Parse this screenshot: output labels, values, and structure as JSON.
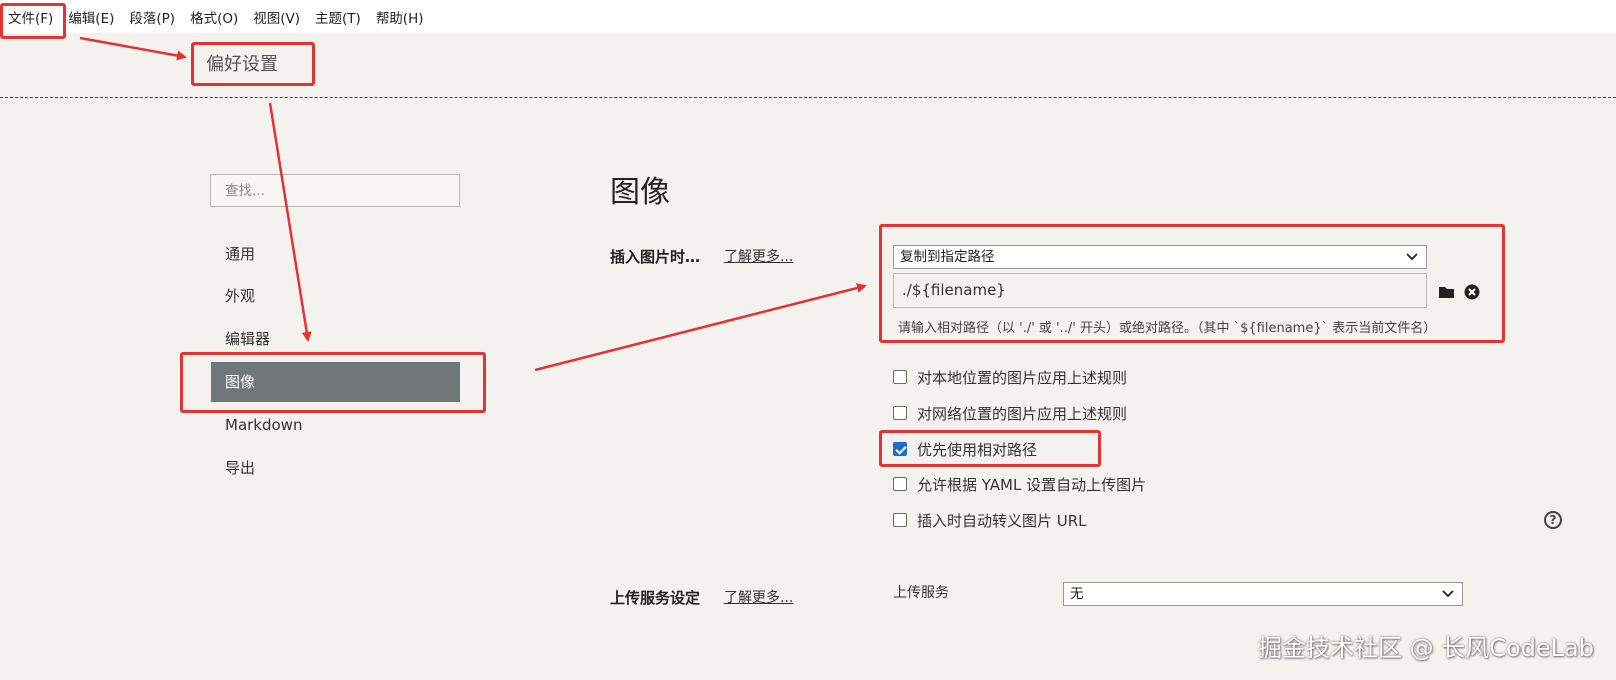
{
  "menubar": {
    "items": [
      "文件(F)",
      "编辑(E)",
      "段落(P)",
      "格式(O)",
      "视图(V)",
      "主题(T)",
      "帮助(H)"
    ]
  },
  "file_menu": {
    "preferences_label": "偏好设置"
  },
  "sidebar": {
    "search_placeholder": "查找...",
    "items": [
      "通用",
      "外观",
      "编辑器",
      "图像",
      "Markdown",
      "导出"
    ],
    "active_item": "图像"
  },
  "image_section": {
    "title": "图像",
    "insert_label": "插入图片时…",
    "learn_more": "了解更多...",
    "insert_action": "复制到指定路径",
    "path_value": "./${filename}",
    "path_hint": "请输入相对路径（以 './' 或 '../' 开头）或绝对路径。（其中 `${filename}` 表示当前文件名）",
    "checkboxes": [
      {
        "label": "对本地位置的图片应用上述规则",
        "checked": false
      },
      {
        "label": "对网络位置的图片应用上述规则",
        "checked": false
      },
      {
        "label": "优先使用相对路径",
        "checked": true
      },
      {
        "label": "允许根据 YAML 设置自动上传图片",
        "checked": false
      },
      {
        "label": "插入时自动转义图片 URL",
        "checked": false
      }
    ],
    "help_icon": "question-circle-icon"
  },
  "upload_section": {
    "label": "上传服务设定",
    "learn_more": "了解更多...",
    "service_label": "上传服务",
    "service_value": "无"
  },
  "annotation_color": "#e53232",
  "selection_color": "#717779",
  "checkbox_color": "#1f6dd1",
  "watermark": "掘金技术社区 @ 长风CodeLab"
}
